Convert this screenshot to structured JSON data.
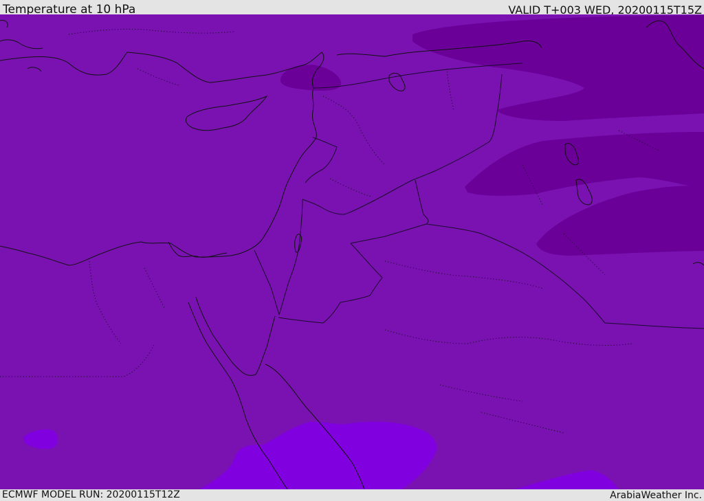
{
  "header": {
    "title": "Temperature at 10 hPa",
    "valid_time": "VALID T+003 WED, 20200115T15Z"
  },
  "footer": {
    "model_run": "ECMWF MODEL RUN: 20200115T12Z",
    "brand": "ArabiaWeather Inc."
  },
  "map": {
    "colors": {
      "base_field": "#7a12b2",
      "cold_field": "#6a0098",
      "warm_field": "#8000e0",
      "coastline": "#111111",
      "border": "#1a0a2a"
    }
  }
}
